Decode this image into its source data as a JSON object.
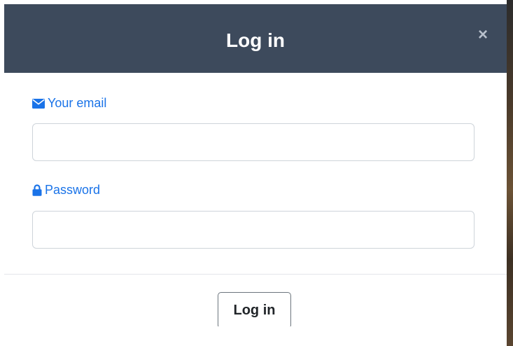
{
  "modal": {
    "title": "Log in",
    "close_glyph": "×",
    "close_icon": "close-icon"
  },
  "form": {
    "email": {
      "label": "Your email",
      "icon": "envelope-icon",
      "value": "",
      "placeholder": ""
    },
    "password": {
      "label": "Password",
      "icon": "lock-icon",
      "value": "",
      "placeholder": ""
    },
    "submit_label": "Log in"
  },
  "colors": {
    "header_bg": "#3d4a5c",
    "label_accent": "#1a73e8",
    "header_text": "#ffffff"
  }
}
